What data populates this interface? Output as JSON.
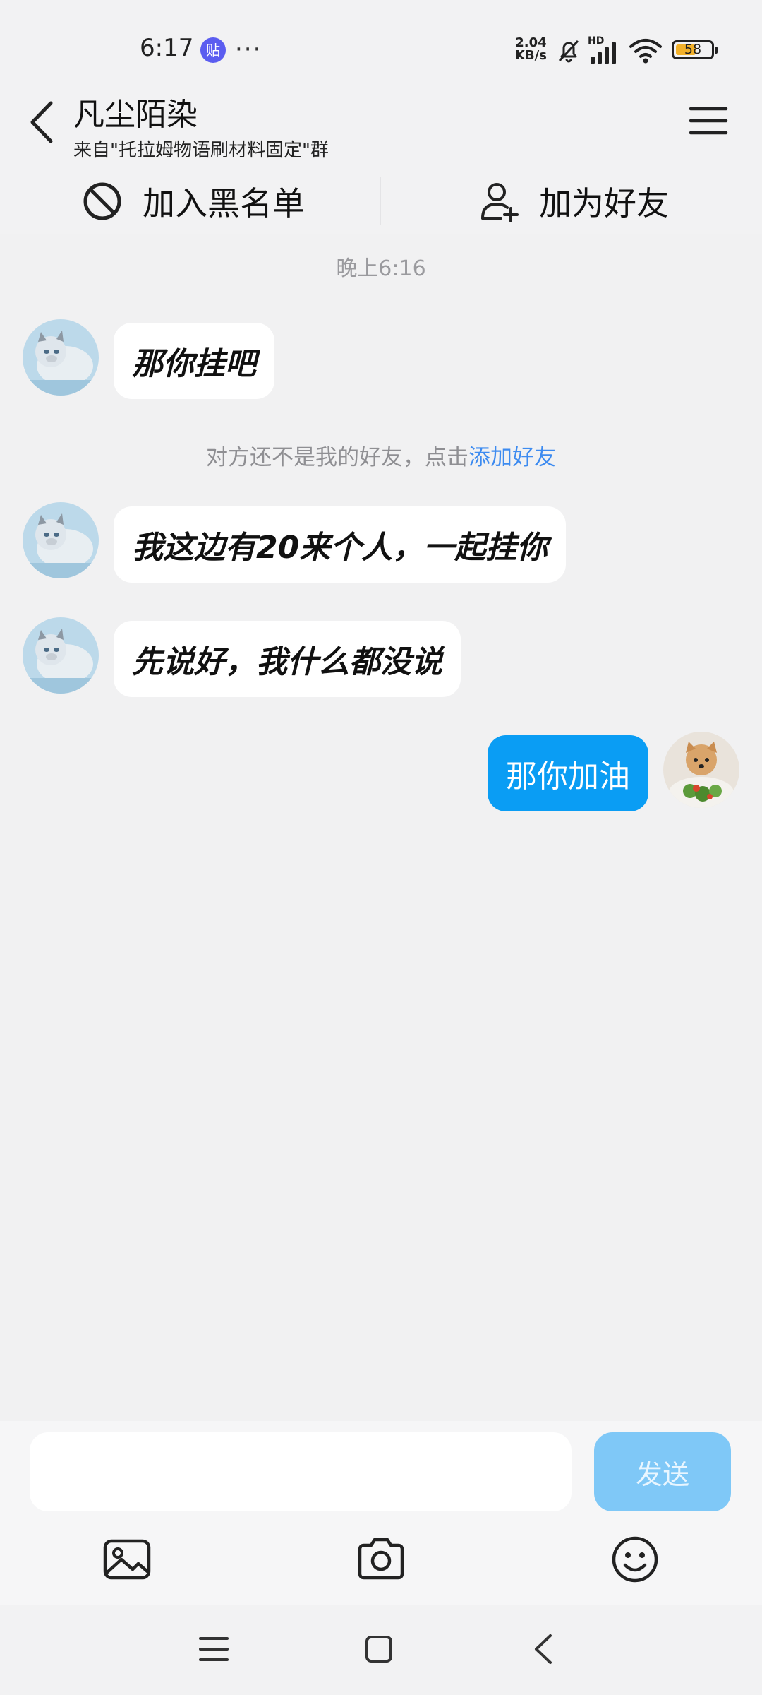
{
  "status_bar": {
    "time": "6:17",
    "notification_badge": "贴",
    "more_indicator": "···",
    "net_speed_value": "2.04",
    "net_speed_unit": "KB/s",
    "hd_label": "HD",
    "battery_level": "58",
    "battery_fraction": 0.58,
    "icons": [
      "mute-bell-icon",
      "signal-icon",
      "wifi-icon",
      "battery-icon"
    ]
  },
  "header": {
    "title": "凡尘陌染",
    "subtitle": "来自\"托拉姆物语刷材料固定\"群",
    "icons": [
      "back-arrow-icon",
      "menu-icon"
    ]
  },
  "actions": {
    "block_label": "加入黑名单",
    "add_friend_label": "加为好友",
    "icons": [
      "block-icon",
      "add-user-icon"
    ]
  },
  "chat": {
    "time_label": "晚上6:16",
    "notice_text": "对方还不是我的好友，点击",
    "notice_link": "添加好友",
    "messages": [
      {
        "sender": "other",
        "text": "那你挂吧"
      },
      {
        "sender": "other",
        "text": "我这边有20来个人，一起挂你"
      },
      {
        "sender": "other",
        "text": "先说好，我什么都没说"
      },
      {
        "sender": "me",
        "text": "那你加油"
      }
    ]
  },
  "input": {
    "placeholder": "",
    "value": "",
    "send_label": "发送",
    "tools": [
      "image-icon",
      "camera-icon",
      "emoji-icon"
    ]
  },
  "nav": {
    "icons": [
      "recents-icon",
      "home-icon",
      "back-icon"
    ]
  },
  "colors": {
    "accent": "#0a9df4",
    "send_disabled": "#7fc8f7",
    "link": "#3d8bf0",
    "battery": "#f2b12a"
  }
}
